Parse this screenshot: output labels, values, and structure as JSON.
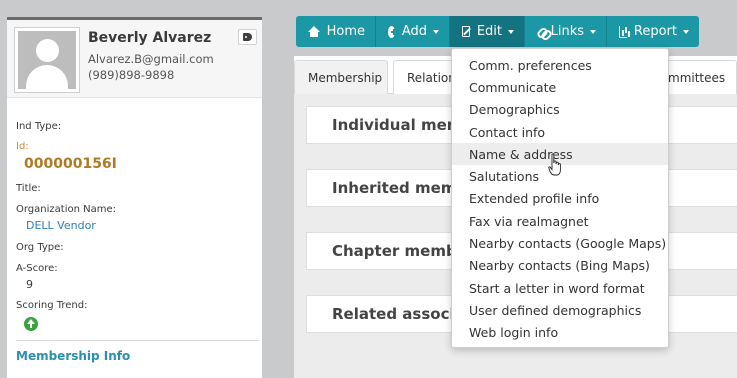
{
  "contact": {
    "name": "Beverly Alvarez",
    "email": "Alvarez.B@gmail.com",
    "phone": "(989)898-9898"
  },
  "fields": {
    "ind_type_label": "Ind Type:",
    "id_label": "Id:",
    "id_value": "000000156I",
    "title_label": "Title:",
    "org_name_label": "Organization Name:",
    "org_name_value": "DELL Vendor",
    "org_type_label": "Org Type:",
    "ascore_label": "A-Score:",
    "ascore_value": "9",
    "scoring_trend_label": "Scoring Trend:",
    "scoring_trend_icon": "arrow-up-circle-icon"
  },
  "membership_info_label": "Membership Info",
  "nav": {
    "home": "Home",
    "add": "Add",
    "edit": "Edit",
    "links": "Links",
    "report": "Report",
    "active": "Edit"
  },
  "tabs": {
    "membership": "Membership",
    "relations": "Relation",
    "committees": "mmittees"
  },
  "cards": {
    "individual": "Individual mem",
    "inherited": "Inherited meml",
    "chapter": "Chapter membe",
    "related": "Related associa"
  },
  "edit_menu": {
    "items": [
      "Comm. preferences",
      "Communicate",
      "Demographics",
      "Contact info",
      "Name & address",
      "Salutations",
      "Extended profile info",
      "Fax via realmagnet",
      "Nearby contacts (Google Maps)",
      "Nearby contacts (Bing Maps)",
      "Start a letter in word format",
      "User defined demographics",
      "Web login info"
    ],
    "hovered": "Name & address"
  },
  "colors": {
    "nav_teal": "#1c97a6",
    "nav_active": "#137380",
    "id_gold": "#b07a25",
    "link_blue": "#2d7fb8",
    "trend_green": "#3aa23f"
  }
}
